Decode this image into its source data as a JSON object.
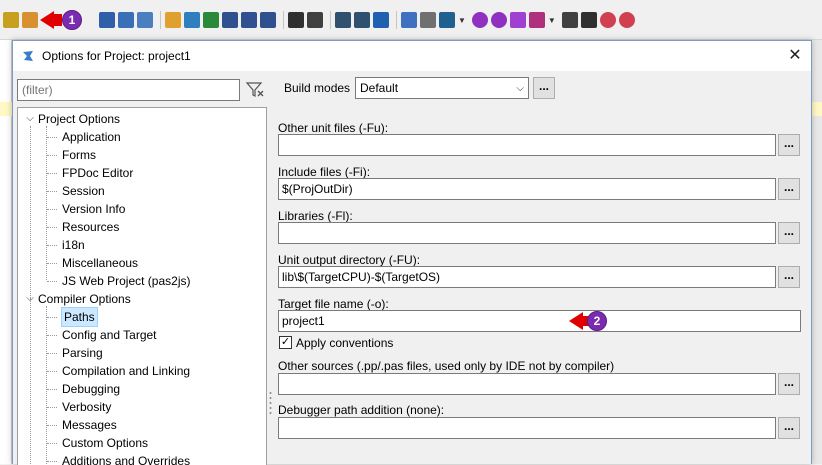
{
  "toolbar": {
    "icons": [
      "find-icon",
      "open-project-icon",
      "new-form-icon",
      "save-icon",
      "save-all-icon",
      "copy-icon",
      "edit-icon",
      "search-icon",
      "component-icon",
      "view-forms-icon",
      "view-units-icon",
      "toggle-icon",
      "find-file-icon",
      "find-replace-icon",
      "build-icon",
      "inspect-icon",
      "package-icon",
      "tools-icon",
      "monitor-icon",
      "settings-icon",
      "settings2-icon",
      "run-icon",
      "run-debug-icon",
      "pause-icon",
      "stop-icon",
      "step-into-icon",
      "step-over-icon"
    ],
    "badge1": "1"
  },
  "dialog": {
    "title": "Options for Project: project1",
    "close": "✕"
  },
  "filter": {
    "placeholder": "(filter)"
  },
  "tree": {
    "project_options": "Project Options",
    "project_children": [
      "Application",
      "Forms",
      "FPDoc Editor",
      "Session",
      "Version Info",
      "Resources",
      "i18n",
      "Miscellaneous",
      "JS Web Project (pas2js)"
    ],
    "compiler_options": "Compiler Options",
    "compiler_children": [
      "Paths",
      "Config and Target",
      "Parsing",
      "Compilation and Linking",
      "Debugging",
      "Verbosity",
      "Messages",
      "Custom Options",
      "Additions and Overrides"
    ],
    "selected": "Paths"
  },
  "build_modes": {
    "label": "Build modes",
    "value": "Default",
    "button": "..."
  },
  "fields": [
    {
      "label": "Other unit files (-Fu):",
      "value": ""
    },
    {
      "label": "Include files (-Fi):",
      "value": "$(ProjOutDir)"
    },
    {
      "label": "Libraries (-Fl):",
      "value": ""
    },
    {
      "label": "Unit output directory (-FU):",
      "value": "lib\\$(TargetCPU)-$(TargetOS)"
    }
  ],
  "target": {
    "label": "Target file name (-o):",
    "value": "project1",
    "badge": "2"
  },
  "apply_conventions": {
    "label": "Apply conventions",
    "checked": "✓"
  },
  "other_sources": {
    "label": "Other sources (.pp/.pas files, used only by IDE not by compiler)",
    "value": ""
  },
  "debugger_path": {
    "label": "Debugger path addition (none):",
    "value": ""
  },
  "browse": "...",
  "colors": {
    "badge": "#7b2bb0",
    "arrow": "#e00000",
    "selection": "#cce8ff"
  }
}
